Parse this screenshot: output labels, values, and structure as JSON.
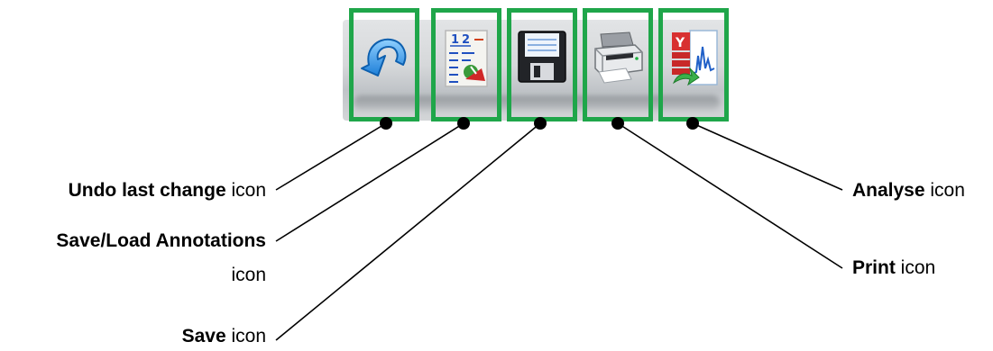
{
  "toolbar": {
    "buttons": [
      {
        "id": "undo",
        "icon": "undo-icon"
      },
      {
        "id": "annotations",
        "icon": "annotations-icon"
      },
      {
        "id": "save",
        "icon": "floppy-disk-icon"
      },
      {
        "id": "print",
        "icon": "printer-icon"
      },
      {
        "id": "analyse",
        "icon": "analyse-icon"
      }
    ],
    "highlight_color": "#1fa64a"
  },
  "callouts": {
    "undo": {
      "bold": "Undo last change",
      "rest": " icon"
    },
    "annotations": {
      "bold": "Save/Load Annotations",
      "rest": "icon"
    },
    "save": {
      "bold": "Save",
      "rest": " icon"
    },
    "print": {
      "bold": "Print",
      "rest": " icon"
    },
    "analyse": {
      "bold": "Analyse",
      "rest": " icon"
    }
  }
}
